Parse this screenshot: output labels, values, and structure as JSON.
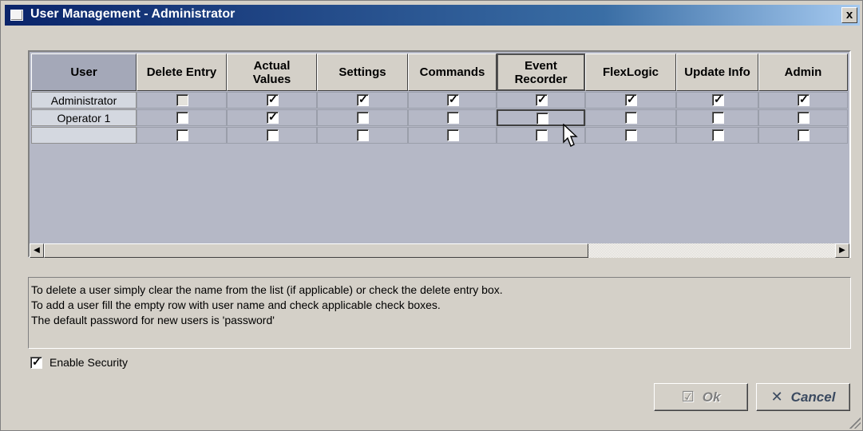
{
  "window": {
    "title": "User Management - Administrator",
    "close_label": "x"
  },
  "grid": {
    "columns": [
      {
        "label": "User"
      },
      {
        "label": "Delete Entry"
      },
      {
        "label": "Actual\nValues"
      },
      {
        "label": "Settings"
      },
      {
        "label": "Commands"
      },
      {
        "label": "Event\nRecorder"
      },
      {
        "label": "FlexLogic"
      },
      {
        "label": "Update Info"
      },
      {
        "label": "Admin"
      }
    ],
    "rows": [
      {
        "user": "Administrator",
        "checks": [
          false,
          true,
          true,
          true,
          true,
          true,
          true,
          true
        ],
        "delete_disabled": true
      },
      {
        "user": "Operator 1",
        "checks": [
          false,
          true,
          false,
          false,
          false,
          false,
          false,
          false
        ]
      },
      {
        "user": "",
        "checks": [
          false,
          false,
          false,
          false,
          false,
          false,
          false,
          false
        ]
      }
    ]
  },
  "info": {
    "line1": "To delete a user simply clear the name from the list (if applicable) or check the delete entry box.",
    "line2": "To add a user fill the empty row with user name and check applicable check boxes.",
    "line3": "The default password for new users is 'password'"
  },
  "security": {
    "label": "Enable Security",
    "checked": true
  },
  "buttons": {
    "ok_label": "Ok",
    "cancel_label": "Cancel",
    "ok_enabled": false
  }
}
